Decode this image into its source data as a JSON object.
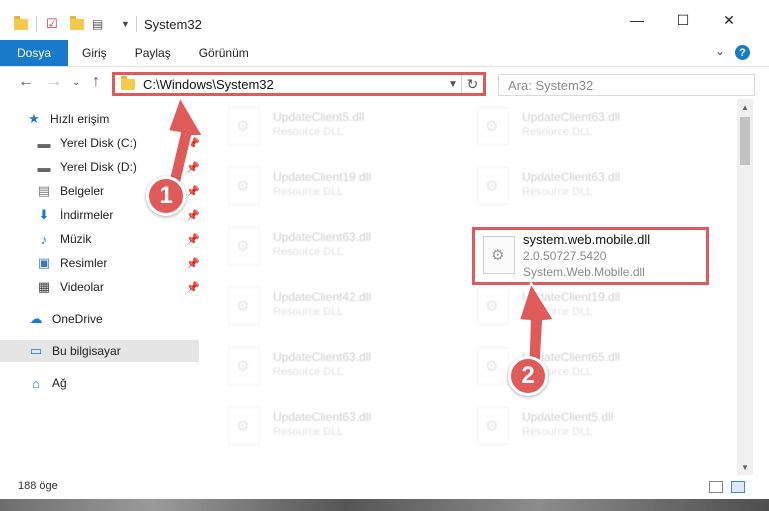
{
  "window": {
    "title": "System32",
    "minimize": "—",
    "maximize": "☐",
    "close": "✕"
  },
  "ribbon": {
    "tabs": [
      "Dosya",
      "Giriş",
      "Paylaş",
      "Görünüm"
    ],
    "expand": "⌄",
    "help": "?"
  },
  "nav": {
    "back": "←",
    "forward": "→",
    "up": "↑",
    "recent": "⌄",
    "address": "C:\\Windows\\System32",
    "address_drop": "▼",
    "refresh": "↻",
    "search_placeholder": "Ara: System32"
  },
  "sidebar": {
    "items": [
      {
        "label": "Hızlı erişim",
        "icon": "star-icon"
      },
      {
        "label": "Yerel Disk (C:)",
        "icon": "drive-icon"
      },
      {
        "label": "Yerel Disk (D:)",
        "icon": "drive-icon"
      },
      {
        "label": "Belgeler",
        "icon": "document-icon"
      },
      {
        "label": "İndirmeler",
        "icon": "download-icon"
      },
      {
        "label": "Müzik",
        "icon": "music-icon"
      },
      {
        "label": "Resimler",
        "icon": "pictures-icon"
      },
      {
        "label": "Videolar",
        "icon": "video-icon"
      },
      {
        "label": "OneDrive",
        "icon": "cloud-icon"
      },
      {
        "label": "Bu bilgisayar",
        "icon": "computer-icon"
      },
      {
        "label": "Ağ",
        "icon": "network-icon"
      }
    ]
  },
  "files": {
    "left": [
      {
        "name": "UpdateClient5.dll",
        "type": "Resource DLL"
      },
      {
        "name": "UpdateClient19.dll",
        "type": "Resource DLL"
      },
      {
        "name": "UpdateClient63.dll",
        "type": "Resource DLL"
      },
      {
        "name": "UpdateClient42.dll",
        "type": "Resource DLL"
      },
      {
        "name": "UpdateClient63.dll",
        "type": "Resource DLL"
      },
      {
        "name": "UpdateClient63.dll",
        "type": "Resource DLL"
      }
    ],
    "right": [
      {
        "name": "UpdateClient63.dll",
        "type": "Resource DLL"
      },
      {
        "name": "UpdateClient63.dll",
        "type": "Resource DLL"
      },
      {
        "name": "UpdateClient19.dll",
        "type": "Resource DLL"
      },
      {
        "name": "UpdateClient65.dll",
        "type": "Resource DLL"
      },
      {
        "name": "UpdateClient5.dll",
        "type": "Resource DLL"
      }
    ],
    "highlighted": {
      "name": "system.web.mobile.dll",
      "version": "2.0.50727.5420",
      "description": "System.Web.Mobile.dll"
    }
  },
  "status": {
    "count": "188 öge"
  },
  "annotations": {
    "badge1": "1",
    "badge2": "2",
    "color": "#e05a5a"
  },
  "colors": {
    "accent": "#1979ca",
    "highlight_border": "#e05a5a"
  }
}
